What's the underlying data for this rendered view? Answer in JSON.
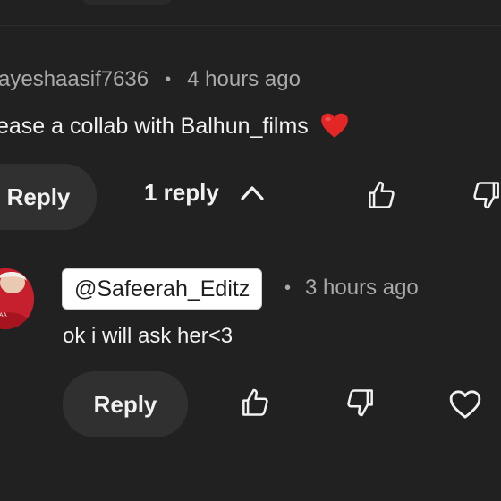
{
  "comment": {
    "author": "ayeshaasif7636",
    "separator": "•",
    "time": "4 hours ago",
    "text": "ease a collab with Balhun_films",
    "emoji_name": "red-heart-emoji"
  },
  "comment_actions": {
    "reply_label": "Reply",
    "replies_count_label": "1 reply",
    "toggle_icon": "chevron-up-icon",
    "like_icon": "thumb-up-icon",
    "dislike_icon": "thumb-down-icon"
  },
  "reply": {
    "mention": "@Safeerah_Editz",
    "separator": "•",
    "time": "3 hours ago",
    "text": "ok i will ask her<3",
    "avatar_icon": "avatar"
  },
  "reply_actions": {
    "reply_label": "Reply",
    "like_icon": "thumb-up-icon",
    "dislike_icon": "thumb-down-icon",
    "heart_icon": "heart-outline-icon"
  },
  "colors": {
    "background": "#212121",
    "pill": "#303030",
    "primary_text": "#f1f1f1",
    "secondary_text": "#aaaaaa",
    "heart": "#e32626",
    "mention_chip_bg": "#ffffff",
    "avatar_bg": "#c6202f"
  }
}
